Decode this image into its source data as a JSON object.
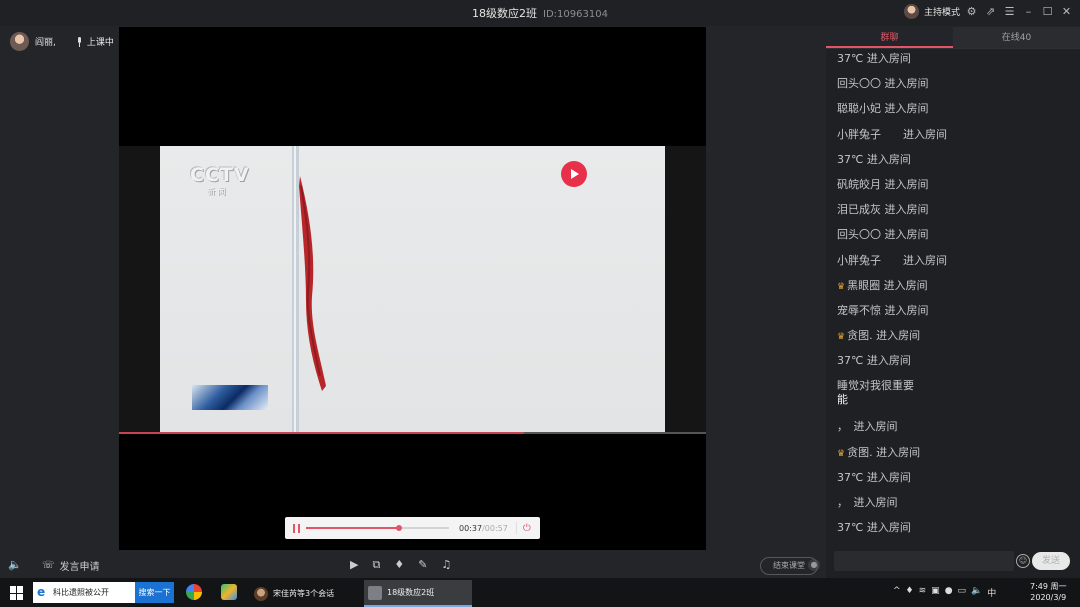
{
  "window": {
    "title": "18级数应2班",
    "room_id": "ID:10963104",
    "host_mode": "主持模式"
  },
  "teacher": {
    "name": "阎丽,",
    "status": "上课中"
  },
  "video": {
    "logo_text": "CCTV",
    "logo_sub": "新 闻",
    "progress": 0.69
  },
  "player": {
    "current": "00:37",
    "duration": "/00:57",
    "progress": 0.65
  },
  "toolbar": {
    "apply_speak": "发言申请",
    "end_class": "结束课堂"
  },
  "panel": {
    "tabs": [
      {
        "label": "群聊"
      },
      {
        "label": "在线40"
      }
    ],
    "messages": [
      {
        "text": "37℃ 进入房间",
        "badge": ""
      },
      {
        "text": "回头〇〇 进入房间",
        "badge": ""
      },
      {
        "text": "聪聪小妃 进入房间",
        "badge": ""
      },
      {
        "text": "小胖兔子　　进入房间",
        "badge": ""
      },
      {
        "text": "37℃ 进入房间",
        "badge": ""
      },
      {
        "text": "矾皖皎月 进入房间",
        "badge": ""
      },
      {
        "text": "泪已成灰 进入房间",
        "badge": ""
      },
      {
        "text": "回头〇〇 进入房间",
        "badge": ""
      },
      {
        "text": "小胖兔子　　进入房间",
        "badge": ""
      },
      {
        "text": "黑眼圈 进入房间",
        "badge": "♛"
      },
      {
        "text": "宠辱不惊 进入房间",
        "badge": ""
      },
      {
        "text": "贪图. 进入房间",
        "badge": "♛"
      },
      {
        "text": "37℃ 进入房间",
        "badge": ""
      }
    ],
    "multi_message": {
      "sender": "睡觉对我很重要",
      "content": "能"
    },
    "messages_after": [
      {
        "text": "，　进入房间",
        "badge": ""
      },
      {
        "text": "贪图. 进入房间",
        "badge": "♛"
      },
      {
        "text": "37℃ 进入房间",
        "badge": ""
      },
      {
        "text": "，　进入房间",
        "badge": ""
      },
      {
        "text": "37℃ 进入房间",
        "badge": ""
      }
    ],
    "send_label": "发送"
  },
  "taskbar": {
    "search_text": "科比遗照被公开",
    "search_button": "搜索一下",
    "apps": [
      {
        "label": "宋佳芮等3个会话"
      },
      {
        "label": "18级数应2班"
      }
    ],
    "ime": "中",
    "time": "7:49 周一",
    "date": "2020/3/9"
  },
  "colors": {
    "accent": "#e05666",
    "panel_bg": "#1f2023",
    "stage_bg": "#000000"
  }
}
